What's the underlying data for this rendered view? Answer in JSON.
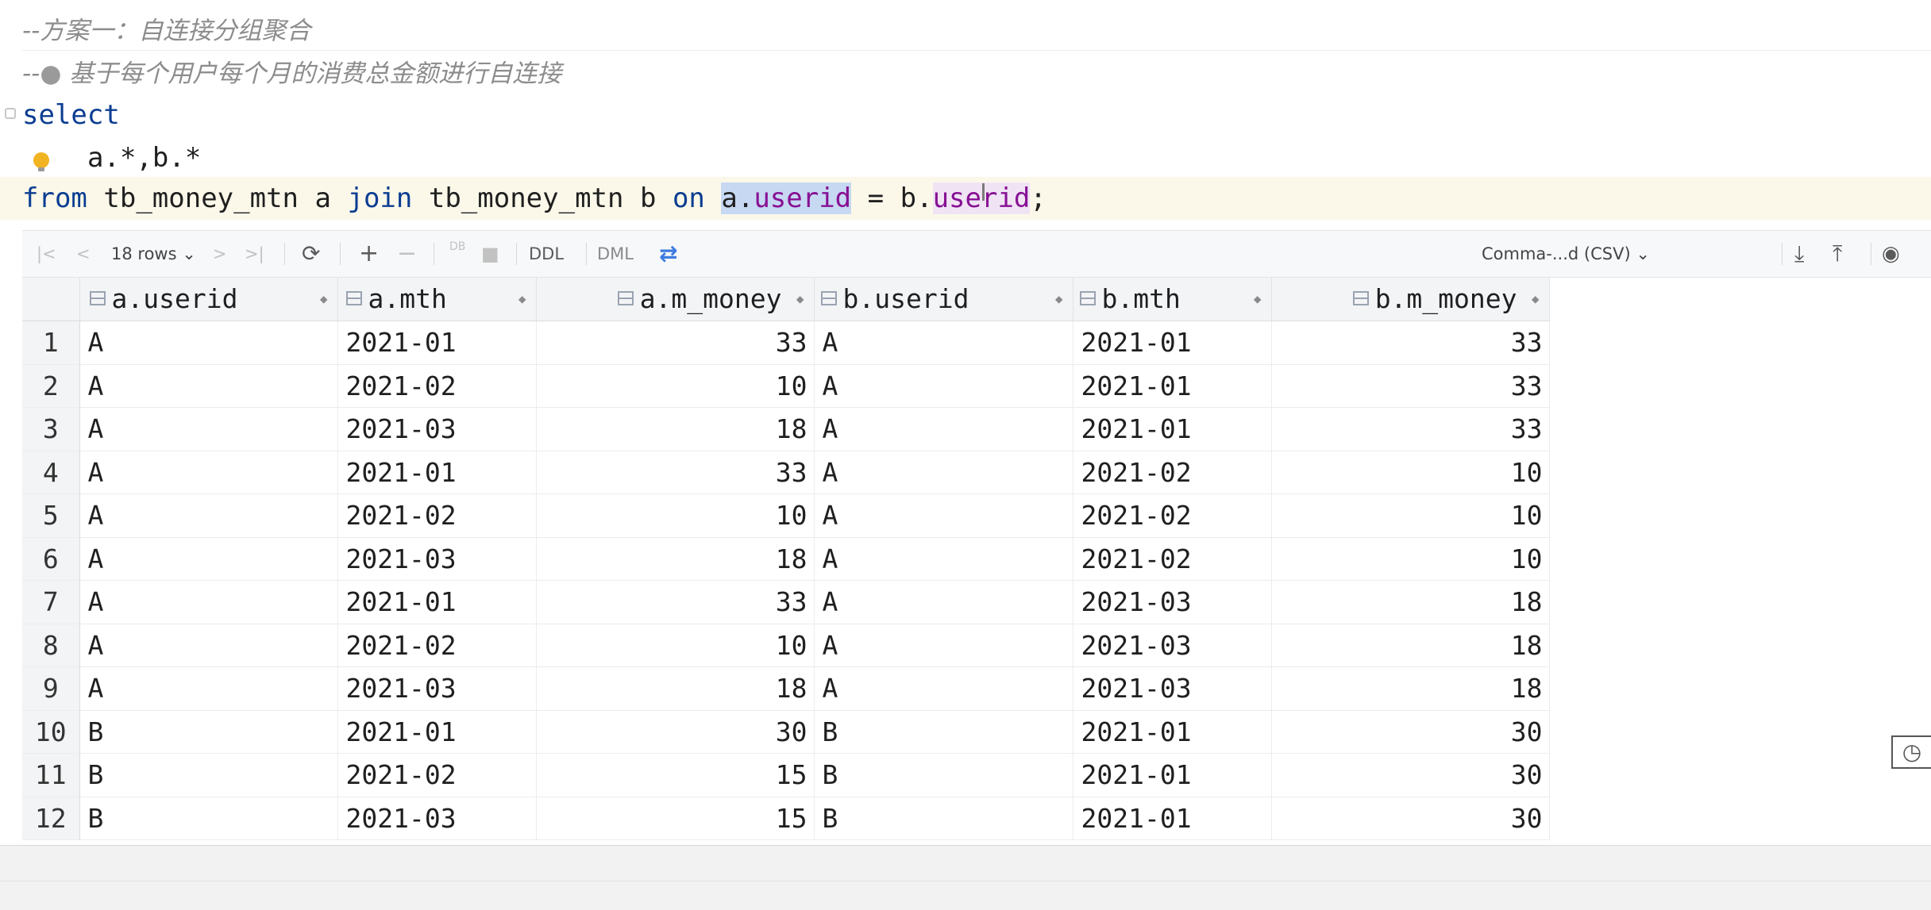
{
  "editor": {
    "line1": "--方案一：自连接分组聚合",
    "line2_prefix": "--",
    "line2_bullet": "●",
    "line2_text": " 基于每个用户每个月的消费总金额进行自连接",
    "kw_select": "select",
    "select_list": "a.*,b.*",
    "kw_from": "from",
    "table1": "tb_money_mtn",
    "alias_a": "a",
    "kw_join": "join",
    "table2": "tb_money_mtn",
    "alias_b": "b",
    "kw_on": "on",
    "cond_left_prefix": "a.",
    "cond_left_field": "userid",
    "eq": "=",
    "cond_right_prefix": "b.",
    "cond_right_field": "userid",
    "semicolon": ";"
  },
  "toolbar": {
    "first": "|<",
    "prev": "<",
    "rows_label": "18 rows",
    "rows_chevron": "⌄",
    "next": ">",
    "last": ">|",
    "refresh": "⟳",
    "add": "+",
    "remove": "−",
    "db_submit": "DB",
    "stop": "■",
    "ddl": "DDL",
    "dml": "DML",
    "compare": "⇄",
    "export_format": "Comma-...d (CSV)",
    "format_chevron": "⌄",
    "download": "⤓",
    "upload": "⤒",
    "view": "◉"
  },
  "table": {
    "columns": [
      "a.userid",
      "a.mth",
      "a.m_money",
      "b.userid",
      "b.mth",
      "b.m_money"
    ],
    "rows": [
      [
        "1",
        "A",
        "2021-01",
        "33",
        "A",
        "2021-01",
        "33"
      ],
      [
        "2",
        "A",
        "2021-02",
        "10",
        "A",
        "2021-01",
        "33"
      ],
      [
        "3",
        "A",
        "2021-03",
        "18",
        "A",
        "2021-01",
        "33"
      ],
      [
        "4",
        "A",
        "2021-01",
        "33",
        "A",
        "2021-02",
        "10"
      ],
      [
        "5",
        "A",
        "2021-02",
        "10",
        "A",
        "2021-02",
        "10"
      ],
      [
        "6",
        "A",
        "2021-03",
        "18",
        "A",
        "2021-02",
        "10"
      ],
      [
        "7",
        "A",
        "2021-01",
        "33",
        "A",
        "2021-03",
        "18"
      ],
      [
        "8",
        "A",
        "2021-02",
        "10",
        "A",
        "2021-03",
        "18"
      ],
      [
        "9",
        "A",
        "2021-03",
        "18",
        "A",
        "2021-03",
        "18"
      ],
      [
        "10",
        "B",
        "2021-01",
        "30",
        "B",
        "2021-01",
        "30"
      ],
      [
        "11",
        "B",
        "2021-02",
        "15",
        "B",
        "2021-01",
        "30"
      ],
      [
        "12",
        "B",
        "2021-03",
        "15",
        "B",
        "2021-01",
        "30"
      ]
    ]
  },
  "colors": {
    "keyword": "#0b3d91",
    "field": "#871094",
    "comment": "#8c8c8c",
    "highlight_a": "#c7d8f2",
    "highlight_b": "#f0e4f4",
    "bulb": "#f2b321"
  }
}
